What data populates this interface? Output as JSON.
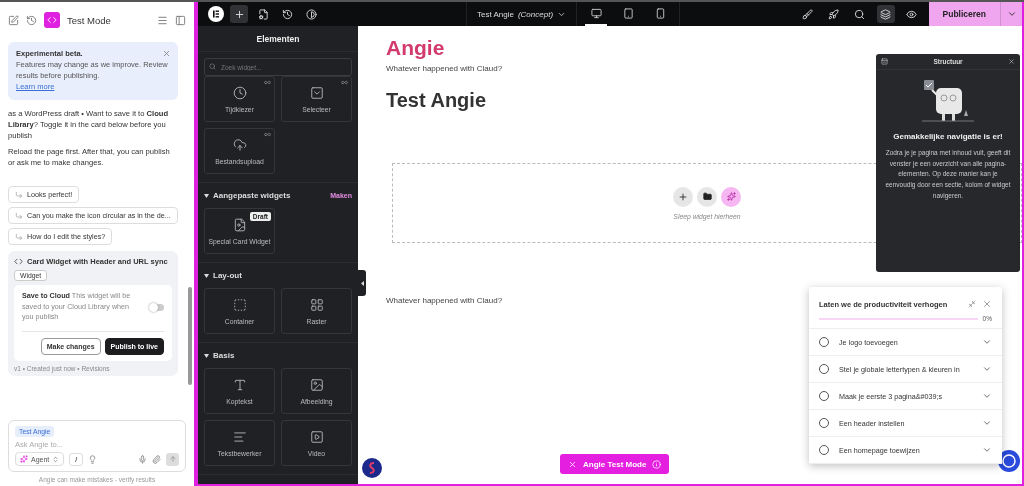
{
  "assistant": {
    "title": "Test Mode",
    "banner": {
      "title": "Experimental beta.",
      "text": "Features may change as we improve. Review results before publishing.",
      "link": "Learn more"
    },
    "messages": [
      "as a WordPress draft • Want to save it to **Cloud Library**? Toggle it in the card below before you publish",
      "Reload the page first. After that, you can publish or ask me to make changes."
    ],
    "suggestions": [
      "Looks perfect!",
      "Can you make the icon circular as in the de...",
      "How do I edit the styles?"
    ],
    "card": {
      "title": "Card Widget with Header and URL sync",
      "tag": "Widget",
      "save_title": "Save to Cloud",
      "save_text": "This widget will be saved to your Cloud Library when you publish",
      "save_on": false,
      "secondary": "Make changes",
      "primary": "Publish to live",
      "meta": "v1 • Created just now • Revisions"
    },
    "composer": {
      "chip": "Test Angie",
      "placeholder": "Ask Angie to...",
      "mode": "Agent",
      "slash": "/",
      "footer": "Angie can make mistakes - verify results"
    }
  },
  "toolbar": {
    "tools": [
      {
        "kind": "add",
        "selected": true
      },
      {
        "kind": "page",
        "selected": false
      },
      {
        "kind": "history",
        "selected": false
      },
      {
        "kind": "contrast",
        "selected": false
      }
    ],
    "page_title": "Test Angie",
    "page_status": "(Concept)",
    "devices": [
      {
        "kind": "desktop",
        "selected": true
      },
      {
        "kind": "tablet",
        "selected": false
      },
      {
        "kind": "mobile",
        "selected": false
      }
    ],
    "actions": [
      {
        "kind": "brush",
        "selected": false
      },
      {
        "kind": "rocket",
        "selected": false
      },
      {
        "kind": "search",
        "selected": false
      },
      {
        "kind": "layers",
        "selected": true
      },
      {
        "kind": "preview",
        "selected": false
      }
    ],
    "publish": "Publiceren"
  },
  "elements": {
    "title": "Elementen",
    "search_placeholder": "Zoek widget...",
    "sections": [
      {
        "widgets": [
          {
            "label": "Tijdkiezer",
            "kind": "clock",
            "pro": true
          },
          {
            "label": "Selecteer",
            "kind": "select",
            "pro": true
          },
          {
            "label": "Bestandsupload",
            "kind": "upload",
            "pro": true
          }
        ]
      },
      {
        "title": "Aangepaste widgets",
        "action": "Maken",
        "expanded": true,
        "widgets": [
          {
            "label": "Special Card Widget",
            "kind": "card",
            "badge": "Draft"
          }
        ]
      },
      {
        "title": "Lay-out",
        "expanded": true,
        "widgets": [
          {
            "label": "Container",
            "kind": "container"
          },
          {
            "label": "Raster",
            "kind": "grid"
          }
        ]
      },
      {
        "title": "Basis",
        "expanded": true,
        "widgets": [
          {
            "label": "Koptekst",
            "kind": "heading"
          },
          {
            "label": "Afbeelding",
            "kind": "image"
          },
          {
            "label": "Tekstbewerker",
            "kind": "text"
          },
          {
            "label": "Video",
            "kind": "video"
          }
        ]
      }
    ]
  },
  "canvas": {
    "site_title": "Angie",
    "tagline": "Whatever happened with Claud?",
    "heading": "Test Angie",
    "dropzone": "Sleep widget hierheen",
    "footer_text": "Whatever happened with Claud?",
    "test_mode": "Angie Test Mode"
  },
  "structure": {
    "title": "Structuur",
    "heading": "Gemakkelijke navigatie is er!",
    "text": "Zodra je je pagina met inhoud vult, geeft dit venster je een overzicht van alle pagina-elementen. Op deze manier kan je eenvoudig door een sectie, kolom of widget navigeren."
  },
  "checklist": {
    "title": "Laten we de productiviteit verhogen",
    "level": 0,
    "reading": "0%",
    "items": [
      {
        "label": "Je logo toevoegen",
        "checked": false
      },
      {
        "label": "Stel je globale lettertypen & kleuren in",
        "checked": false
      },
      {
        "label": "Maak je eerste 3 pagina&#039;s",
        "checked": false
      },
      {
        "label": "Een header instellen",
        "checked": false
      },
      {
        "label": "Een homepage toewijzen",
        "checked": false
      }
    ]
  }
}
